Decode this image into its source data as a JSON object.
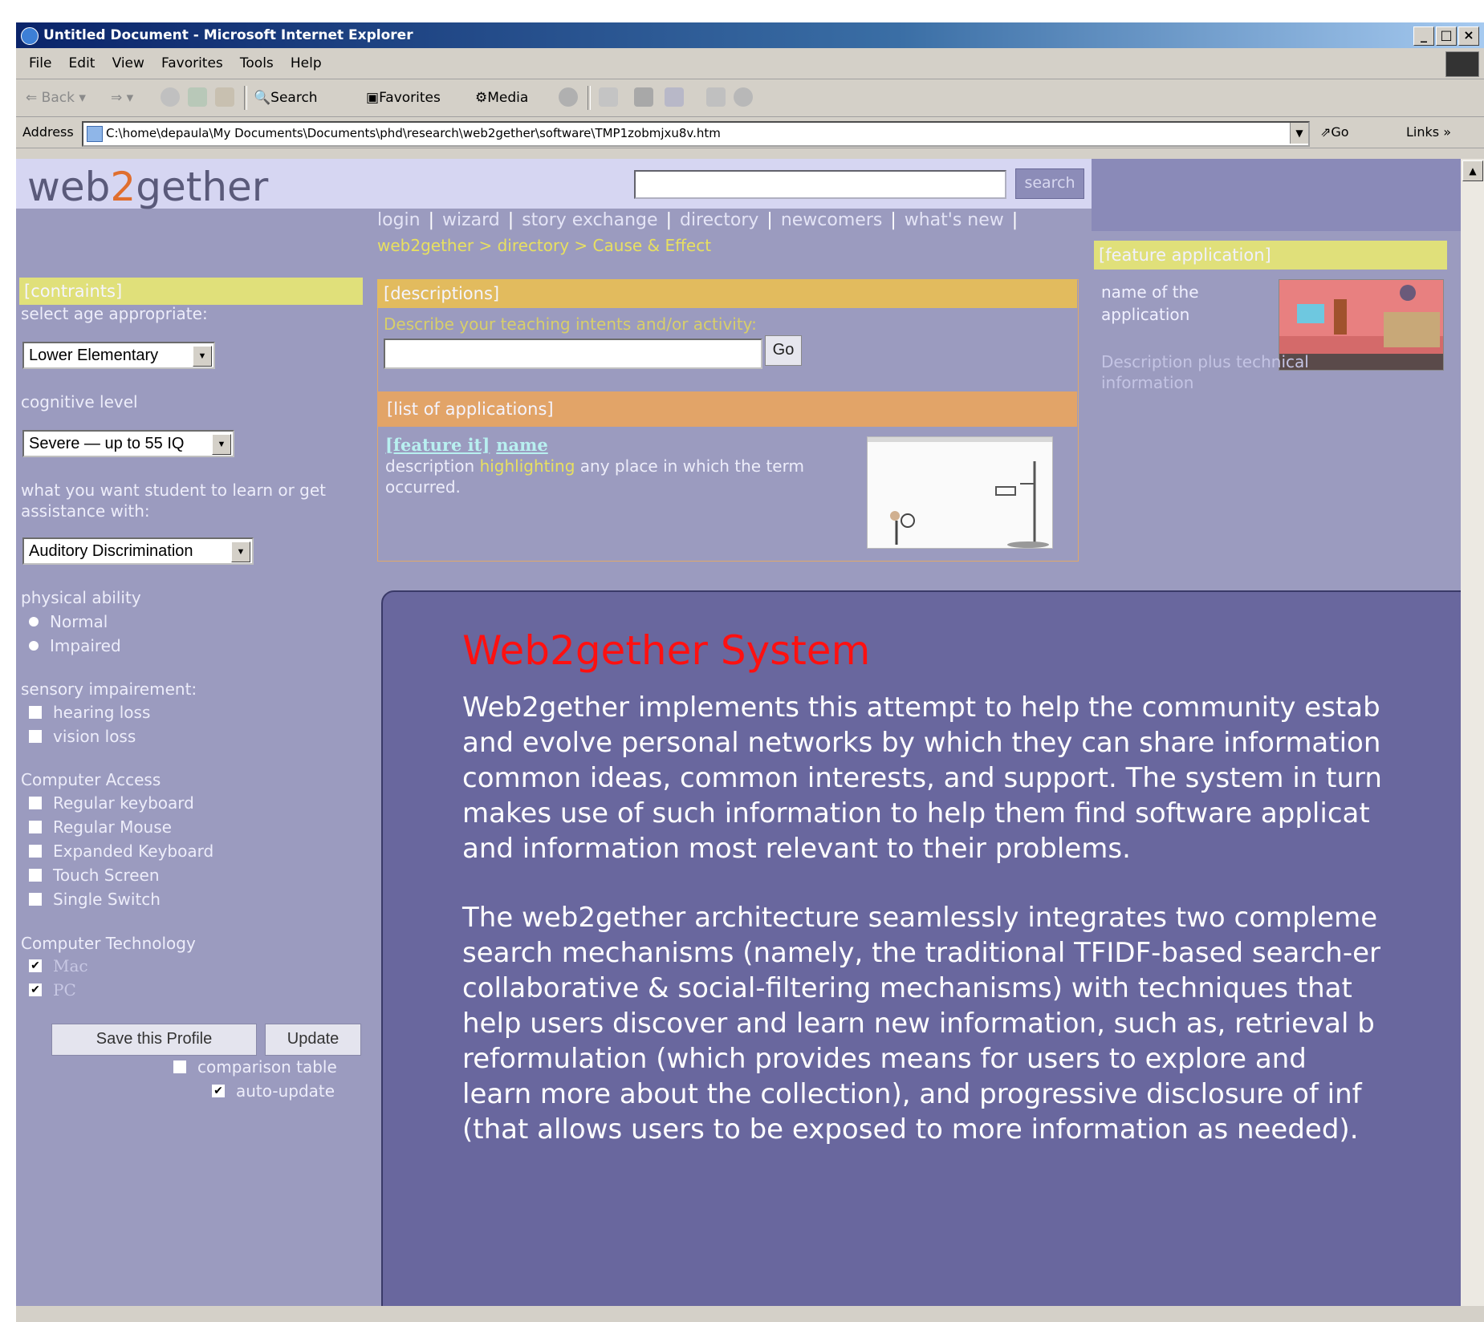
{
  "window": {
    "title": "Untitled Document - Microsoft Internet Explorer",
    "controls": {
      "min": "_",
      "max": "□",
      "close": "×"
    }
  },
  "menu": [
    "File",
    "Edit",
    "View",
    "Favorites",
    "Tools",
    "Help"
  ],
  "toolbar": {
    "back": "Back",
    "search": "Search",
    "favorites": "Favorites",
    "media": "Media"
  },
  "address": {
    "label": "Address",
    "url": "C:\\home\\depaula\\My Documents\\Documents\\phd\\research\\web2gether\\software\\TMP1zobmjxu8v.htm",
    "go": "Go",
    "links": "Links »"
  },
  "page": {
    "logo": {
      "pre": "web",
      "two": "2",
      "post": "gether"
    },
    "search_button": "search",
    "nav": [
      "login",
      "wizard",
      "story exchange",
      "directory",
      "newcomers",
      "what's new"
    ],
    "breadcrumb": "web2gether > directory > Cause & Effect",
    "feature": {
      "header": "[feature application]",
      "name": "name of the application",
      "description": "Description plus technical information"
    },
    "constraints": {
      "header": "[contraints]",
      "age_label": "select age appropriate:",
      "age_value": "Lower Elementary",
      "cognitive_label": "cognitive level",
      "cognitive_value": "Severe — up to 55 IQ",
      "learn_label": "what you want student to learn or get assistance with:",
      "learn_value": "Auditory Discrimination",
      "physical_label": "physical ability",
      "physical_options": [
        "Normal",
        "Impaired"
      ],
      "sensory_label": "sensory impairement:",
      "sensory_options": [
        "hearing loss",
        "vision loss"
      ],
      "access_label": "Computer Access",
      "access_options": [
        "Regular keyboard",
        "Regular Mouse",
        "Expanded Keyboard",
        "Touch Screen",
        "Single Switch"
      ],
      "tech_label": "Computer Technology",
      "tech_options": [
        "Mac",
        "PC"
      ],
      "tech_checked": [
        true,
        true
      ],
      "save_button": "Save this Profile",
      "update_button": "Update",
      "comparison": "comparison table",
      "auto_update": "auto-update",
      "auto_update_checked": true
    },
    "descriptions": {
      "header": "[descriptions]",
      "prompt": "Describe your teaching intents and/or activity:",
      "go": "Go"
    },
    "applications": {
      "header": "[list of applications]",
      "feature_it": "[feature it]",
      "name": "name",
      "desc_pre": "description ",
      "desc_hl": "highlighting",
      "desc_post": " any place in which the term occurred."
    }
  },
  "overlay": {
    "title": "Web2gether System",
    "p1": "Web2gether implements this attempt to help the community estab\nand evolve personal networks by which they can share information\ncommon ideas, common interests, and support. The system in turn\nmakes use of such information to help them find software applicat\nand information most relevant to their problems.",
    "p2": "The web2gether architecture seamlessly integrates two compleme\nsearch mechanisms (namely, the traditional TFIDF-based search-er\ncollaborative & social-filtering mechanisms) with techniques that\nhelp users discover and learn new information, such as, retrieval b\nreformulation (which provides means for users to explore and\nlearn more about the collection), and progressive disclosure of inf\n(that allows users to be exposed to more information as needed)."
  },
  "colors": {
    "page_bg": "#9b9bbf",
    "title_red": "#ff1010",
    "header_yellow": "#e0e07a",
    "header_gold": "#e2bb5e",
    "header_orange": "#e2a468",
    "overlay_bg": "#66649c"
  }
}
